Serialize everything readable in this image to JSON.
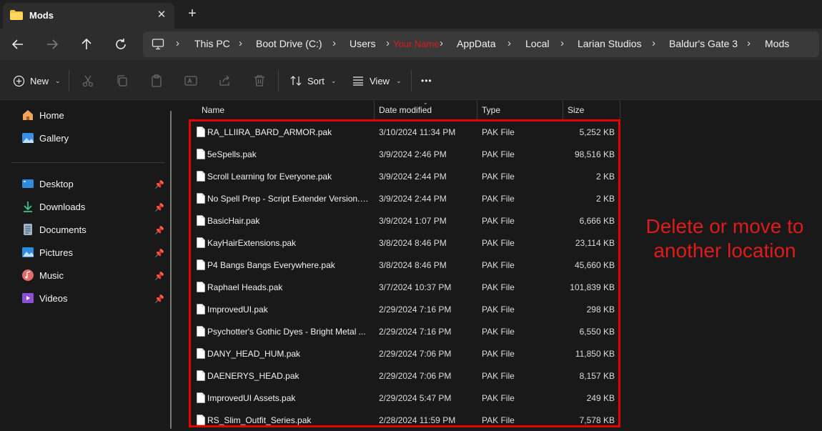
{
  "window": {
    "tab_title": "Mods",
    "tab_close": "✕",
    "new_tab": "+"
  },
  "navigation": {
    "back_icon": "arrow-left-icon",
    "forward_icon": "arrow-right-icon",
    "up_icon": "arrow-up-icon",
    "refresh_icon": "refresh-icon",
    "breadcrumbs": [
      "This PC",
      "Boot Drive (C:)",
      "Users",
      "Your Name",
      "AppData",
      "Local",
      "Larian Studios",
      "Baldur's Gate 3",
      "Mods"
    ],
    "redacted_color": "#e01b1b"
  },
  "toolbar": {
    "new_label": "New",
    "sort_label": "Sort",
    "view_label": "View",
    "more_label": "•••"
  },
  "sidebar": {
    "top_items": [
      {
        "label": "Home",
        "icon": "home-icon"
      },
      {
        "label": "Gallery",
        "icon": "gallery-icon"
      }
    ],
    "pinned_items": [
      {
        "label": "Desktop",
        "icon": "desktop-icon"
      },
      {
        "label": "Downloads",
        "icon": "downloads-icon"
      },
      {
        "label": "Documents",
        "icon": "documents-icon"
      },
      {
        "label": "Pictures",
        "icon": "pictures-icon"
      },
      {
        "label": "Music",
        "icon": "music-icon"
      },
      {
        "label": "Videos",
        "icon": "videos-icon"
      }
    ]
  },
  "file_list": {
    "columns": [
      "Name",
      "Date modified",
      "Type",
      "Size"
    ],
    "rows": [
      {
        "name": "RA_LLIIRA_BARD_ARMOR.pak",
        "date": "3/10/2024 11:34 PM",
        "type": "PAK File",
        "size": "5,252 KB"
      },
      {
        "name": "5eSpells.pak",
        "date": "3/9/2024 2:46 PM",
        "type": "PAK File",
        "size": "98,516 KB"
      },
      {
        "name": "Scroll Learning for Everyone.pak",
        "date": "3/9/2024 2:44 PM",
        "type": "PAK File",
        "size": "2 KB"
      },
      {
        "name": "No Spell Prep - Script Extender Version.pak",
        "date": "3/9/2024 2:44 PM",
        "type": "PAK File",
        "size": "2 KB"
      },
      {
        "name": "BasicHair.pak",
        "date": "3/9/2024 1:07 PM",
        "type": "PAK File",
        "size": "6,666 KB"
      },
      {
        "name": "KayHairExtensions.pak",
        "date": "3/8/2024 8:46 PM",
        "type": "PAK File",
        "size": "23,114 KB"
      },
      {
        "name": "P4 Bangs Bangs Everywhere.pak",
        "date": "3/8/2024 8:46 PM",
        "type": "PAK File",
        "size": "45,660 KB"
      },
      {
        "name": "Raphael Heads.pak",
        "date": "3/7/2024 10:37 PM",
        "type": "PAK File",
        "size": "101,839 KB"
      },
      {
        "name": "ImprovedUI.pak",
        "date": "2/29/2024 7:16 PM",
        "type": "PAK File",
        "size": "298 KB"
      },
      {
        "name": "Psychotter's Gothic Dyes - Bright  Metal ...",
        "date": "2/29/2024 7:16 PM",
        "type": "PAK File",
        "size": "6,550 KB"
      },
      {
        "name": "DANY_HEAD_HUM.pak",
        "date": "2/29/2024 7:06 PM",
        "type": "PAK File",
        "size": "11,850 KB"
      },
      {
        "name": "DAENERYS_HEAD.pak",
        "date": "2/29/2024 7:06 PM",
        "type": "PAK File",
        "size": "8,157 KB"
      },
      {
        "name": "ImprovedUI Assets.pak",
        "date": "2/29/2024 5:47 PM",
        "type": "PAK File",
        "size": "249 KB"
      },
      {
        "name": "RS_Slim_Outfit_Series.pak",
        "date": "2/28/2024 11:59 PM",
        "type": "PAK File",
        "size": "7,578 KB"
      }
    ]
  },
  "annotation": {
    "line1": "Delete or move to",
    "line2": "another location",
    "color": "#e60000"
  }
}
